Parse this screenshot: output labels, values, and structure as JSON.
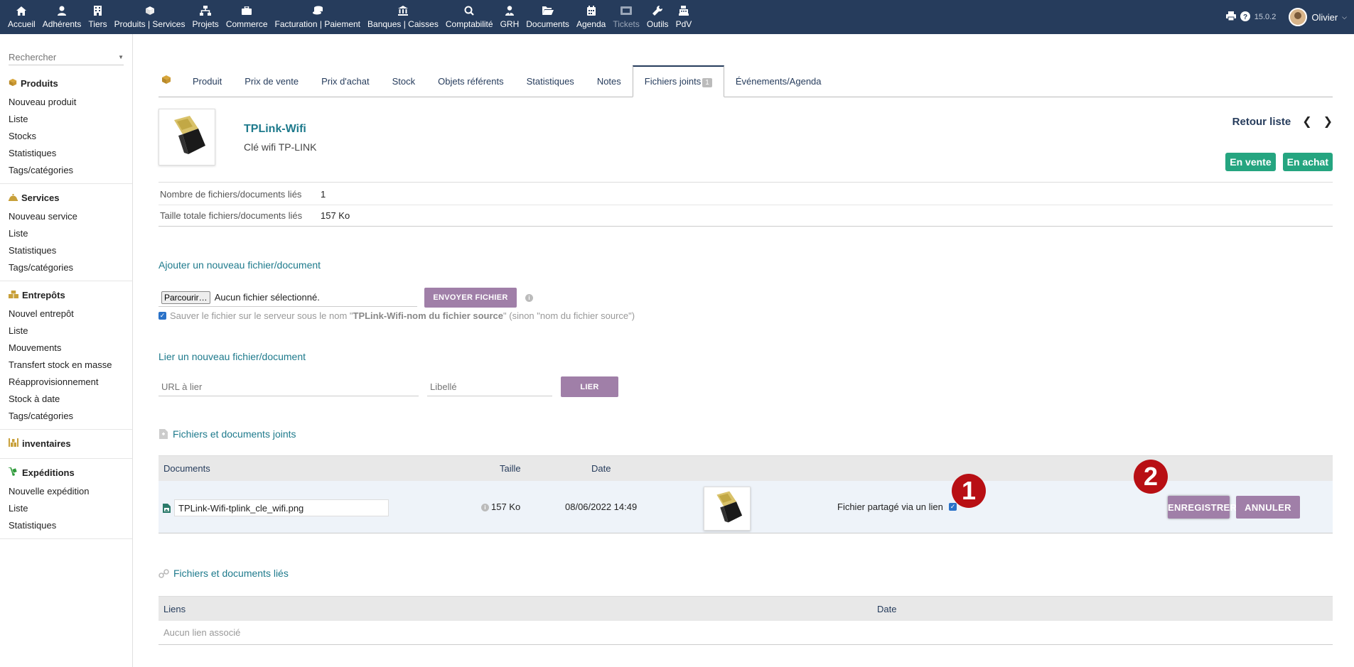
{
  "topmenu": {
    "items": [
      {
        "label": "Accueil",
        "icon": "home-icon"
      },
      {
        "label": "Adhérents",
        "icon": "user-icon"
      },
      {
        "label": "Tiers",
        "icon": "building-icon"
      },
      {
        "label": "Produits | Services",
        "icon": "cube-icon"
      },
      {
        "label": "Projets",
        "icon": "sitemap-icon"
      },
      {
        "label": "Commerce",
        "icon": "briefcase-icon"
      },
      {
        "label": "Facturation | Paiement",
        "icon": "coins-icon"
      },
      {
        "label": "Banques | Caisses",
        "icon": "bank-icon"
      },
      {
        "label": "Comptabilité",
        "icon": "search-dollar-icon"
      },
      {
        "label": "GRH",
        "icon": "user-tie-icon"
      },
      {
        "label": "Documents",
        "icon": "folder-open-icon"
      },
      {
        "label": "Agenda",
        "icon": "calendar-icon"
      },
      {
        "label": "Tickets",
        "icon": "ticket-icon"
      },
      {
        "label": "Outils",
        "icon": "wrench-icon"
      },
      {
        "label": "PdV",
        "icon": "cash-register-icon"
      }
    ],
    "version": "15.0.2",
    "username": "Olivier"
  },
  "sidebar": {
    "search_placeholder": "Rechercher",
    "blocks": [
      {
        "title": "Produits",
        "items": [
          "Nouveau produit",
          "Liste",
          "Stocks",
          "Statistiques",
          "Tags/catégories"
        ]
      },
      {
        "title": "Services",
        "items": [
          "Nouveau service",
          "Liste",
          "Statistiques",
          "Tags/catégories"
        ]
      },
      {
        "title": "Entrepôts",
        "items": [
          "Nouvel entrepôt",
          "Liste",
          "Mouvements",
          "Transfert stock en masse",
          "Réapprovisionnement",
          "Stock à date",
          "Tags/catégories"
        ]
      },
      {
        "title": "inventaires",
        "items": []
      },
      {
        "title": "Expéditions",
        "items": [
          "Nouvelle expédition",
          "Liste",
          "Statistiques"
        ]
      }
    ]
  },
  "tabs": [
    {
      "label": "Produit"
    },
    {
      "label": "Prix de vente"
    },
    {
      "label": "Prix d'achat"
    },
    {
      "label": "Stock"
    },
    {
      "label": "Objets référents"
    },
    {
      "label": "Statistiques"
    },
    {
      "label": "Notes"
    },
    {
      "label": "Fichiers joints",
      "badge": "1"
    },
    {
      "label": "Événements/Agenda"
    }
  ],
  "product": {
    "ref": "TPLink-Wifi",
    "label": "Clé wifi TP-LINK",
    "back_list": "Retour liste",
    "status_sell": "En vente",
    "status_buy": "En achat"
  },
  "info": {
    "count_label": "Nombre de fichiers/documents liés",
    "count_value": "1",
    "size_label": "Taille totale fichiers/documents liés",
    "size_value": "157 Ko"
  },
  "upload": {
    "title": "Ajouter un nouveau fichier/document",
    "browse_label": "Parcourir…",
    "no_file": "Aucun fichier sélectionné.",
    "send_label": "ENVOYER FICHIER",
    "save_note_prefix": "Sauver le fichier sur le serveur sous le nom \"",
    "save_note_bold": "TPLink-Wifi-nom du fichier source",
    "save_note_suffix": "\" (sinon \"nom du fichier source\")"
  },
  "link": {
    "title": "Lier un nouveau fichier/document",
    "url_placeholder": "URL à lier",
    "label_placeholder": "Libellé",
    "link_label": "LIER"
  },
  "attached": {
    "title": "Fichiers et documents joints",
    "columns": {
      "documents": "Documents",
      "size": "Taille",
      "date": "Date"
    },
    "row": {
      "filename": "TPLink-Wifi-tplink_cle_wifi.png",
      "size": "157 Ko",
      "date": "08/06/2022 14:49",
      "share_label": "Fichier partagé via un lien",
      "save_label": "ENREGISTRER",
      "cancel_label": "ANNULER"
    },
    "markers": [
      "1",
      "2"
    ]
  },
  "linked": {
    "title": "Fichiers et documents liés",
    "columns": {
      "links": "Liens",
      "date": "Date"
    },
    "empty": "Aucun lien associé"
  }
}
